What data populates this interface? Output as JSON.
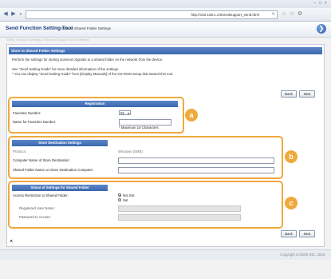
{
  "browser": {
    "url": "http://192.168.1.24/sendsupport_send.html",
    "tab_title": "Store to Shared Folder Settings",
    "nav_back": "◀",
    "nav_forward": "▶"
  },
  "header": {
    "app_title": "Send Function Setting Tool",
    "breadcrumb": "Store to Shared Folder Settings",
    "next_arrow": "❯"
  },
  "crumbs": "SEND Function Settings  >  Store to Shared Folder Settings",
  "panel": {
    "title": "Store to Shared Folder Settings",
    "desc1": "Perform the settings for storing scanned originals to a shared folder on the network from the device.",
    "desc2": "See \"Send Setting Guide\" for more detailed information of the settings.",
    "desc3": "* You can display \"Send Setting Guide\" from [Display Manuals] of the CD-ROM Setup that started this tool."
  },
  "buttons": {
    "back": "Back",
    "next": "Next"
  },
  "registration": {
    "title": "Registration",
    "favorites_label": "Favorites Number:",
    "favorites_value": "02",
    "name_label": "Name for Favorites Number:",
    "name_value": "",
    "max_note": "* Maximum 16 Characters",
    "callout": "a"
  },
  "destination": {
    "title": "Store Destination Settings",
    "protocol_label": "Protocol:",
    "protocol_value": "Windows (SMB)",
    "computer_label": "Computer Name of Store Destination:",
    "computer_value": "",
    "folder_label": "Shared Folder Name on Store Destination Computer:",
    "folder_value": "",
    "callout": "b"
  },
  "status": {
    "title": "Status of Settings for Shared Folder",
    "access_label": "Access Restriction to Shared Folder:",
    "option_notset": "Not Set",
    "option_set": "Set",
    "user_label": "Registered User Name:",
    "password_label": "Password to Access:",
    "callout": "c"
  },
  "footer": {
    "page_top": "⮝",
    "copyright": "Copyright CANON INC. 2015"
  },
  "colors": {
    "accent": "#3c68ad",
    "callout": "#f0a93b"
  }
}
